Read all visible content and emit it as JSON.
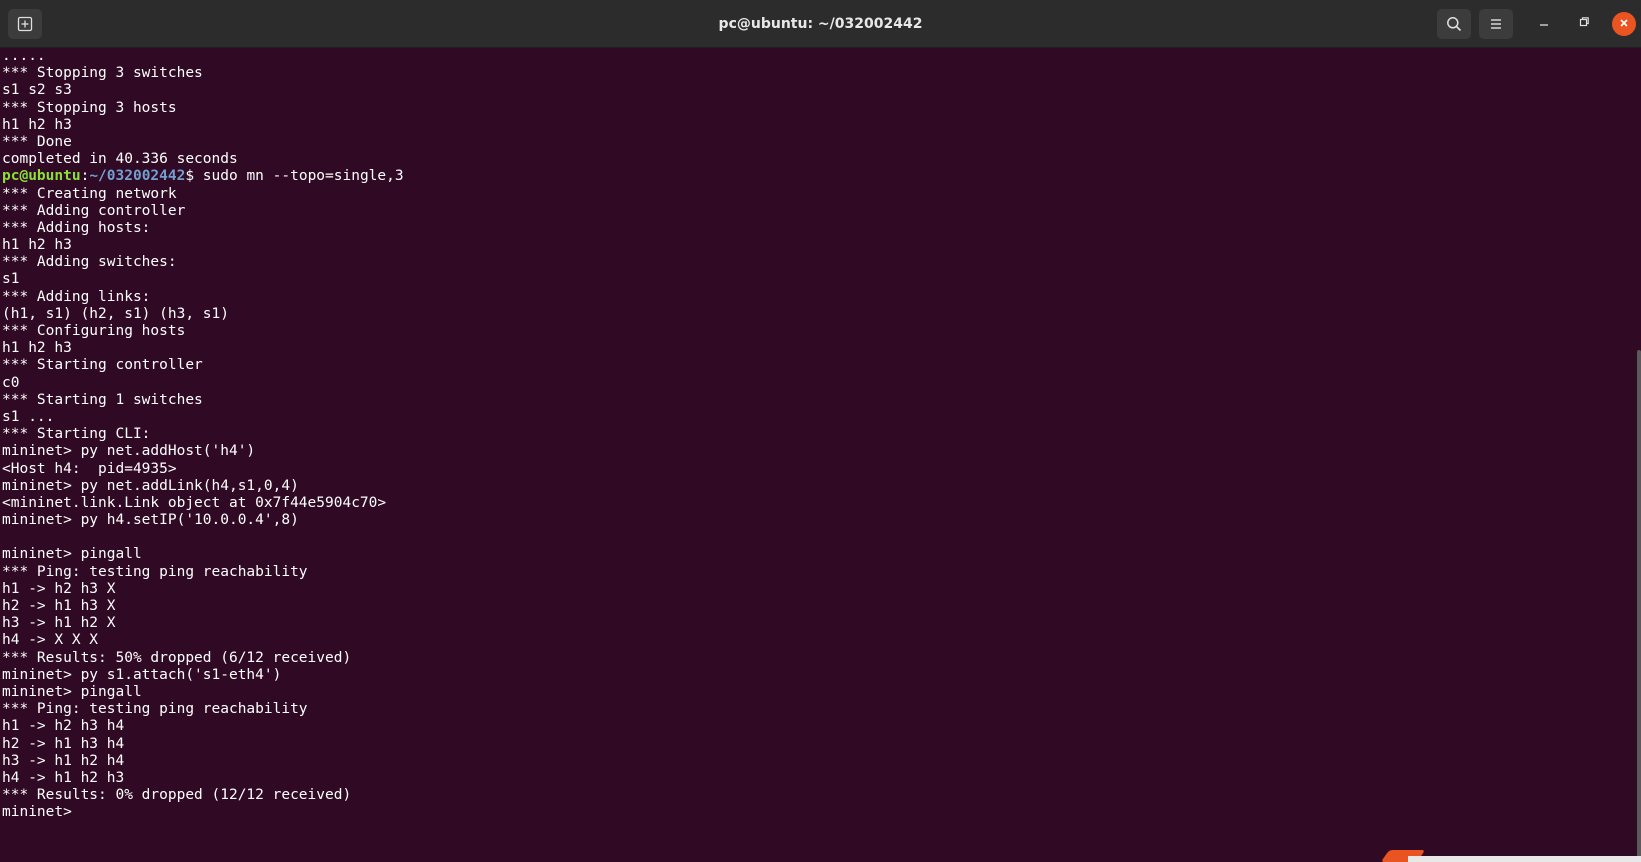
{
  "window": {
    "title": "pc@ubuntu: ~/032002442"
  },
  "titlebar": {
    "new_tab_icon": "new-tab-icon",
    "search_icon": "search-icon",
    "menu_icon": "hamburger-menu-icon",
    "minimize_icon": "minimize-icon",
    "maximize_icon": "maximize-icon",
    "close_icon": "close-icon"
  },
  "colors": {
    "terminal_bg": "#300a24",
    "prompt_user": "#8ae234",
    "prompt_path": "#729fcf",
    "close_button": "#e95420"
  },
  "terminal": {
    "lines_before_prompt": [
      ".....",
      "*** Stopping 3 switches",
      "s1 s2 s3",
      "*** Stopping 3 hosts",
      "h1 h2 h3",
      "*** Done",
      "completed in 40.336 seconds"
    ],
    "prompt": {
      "user": "pc@ubuntu",
      "sep": ":",
      "path": "~/032002442",
      "symbol": "$",
      "command": " sudo mn --topo=single,3"
    },
    "lines_after_prompt": [
      "*** Creating network",
      "*** Adding controller",
      "*** Adding hosts:",
      "h1 h2 h3",
      "*** Adding switches:",
      "s1",
      "*** Adding links:",
      "(h1, s1) (h2, s1) (h3, s1)",
      "*** Configuring hosts",
      "h1 h2 h3",
      "*** Starting controller",
      "c0",
      "*** Starting 1 switches",
      "s1 ...",
      "*** Starting CLI:",
      "mininet> py net.addHost('h4')",
      "<Host h4:  pid=4935>",
      "mininet> py net.addLink(h4,s1,0,4)",
      "<mininet.link.Link object at 0x7f44e5904c70>",
      "mininet> py h4.setIP('10.0.0.4',8)",
      "",
      "mininet> pingall",
      "*** Ping: testing ping reachability",
      "h1 -> h2 h3 X",
      "h2 -> h1 h3 X",
      "h3 -> h1 h2 X",
      "h4 -> X X X",
      "*** Results: 50% dropped (6/12 received)",
      "mininet> py s1.attach('s1-eth4')",
      "mininet> pingall",
      "*** Ping: testing ping reachability",
      "h1 -> h2 h3 h4",
      "h2 -> h1 h3 h4",
      "h3 -> h1 h2 h4",
      "h4 -> h1 h2 h3",
      "*** Results: 0% dropped (12/12 received)",
      "mininet> "
    ]
  }
}
